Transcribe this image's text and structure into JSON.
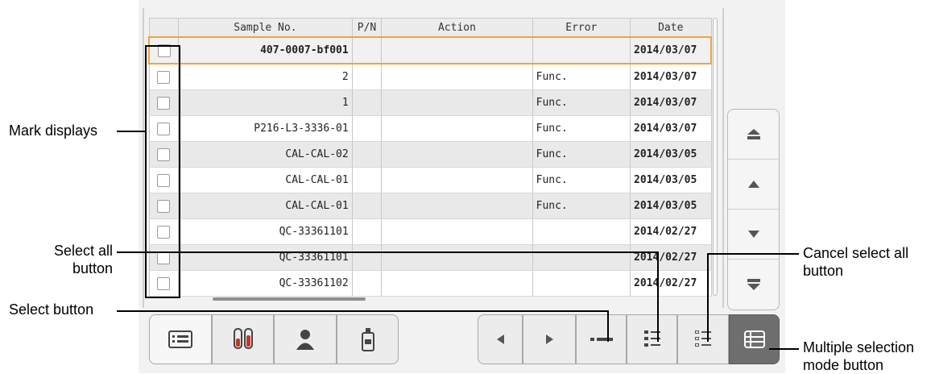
{
  "table": {
    "columns": [
      "",
      "Sample No.",
      "P/N",
      "Action",
      "Error",
      "Date"
    ],
    "rows": [
      {
        "sample": "407-0007-bf001",
        "pn": "",
        "action": "",
        "error": "",
        "date": "2014/03/07"
      },
      {
        "sample": "2",
        "pn": "",
        "action": "",
        "error": "Func.",
        "date": "2014/03/07"
      },
      {
        "sample": "1",
        "pn": "",
        "action": "",
        "error": "Func.",
        "date": "2014/03/07"
      },
      {
        "sample": "P216-L3-3336-01",
        "pn": "",
        "action": "",
        "error": "Func.",
        "date": "2014/03/07"
      },
      {
        "sample": "CAL-CAL-02",
        "pn": "",
        "action": "",
        "error": "Func.",
        "date": "2014/03/05"
      },
      {
        "sample": "CAL-CAL-01",
        "pn": "",
        "action": "",
        "error": "Func.",
        "date": "2014/03/05"
      },
      {
        "sample": "CAL-CAL-01",
        "pn": "",
        "action": "",
        "error": "Func.",
        "date": "2014/03/05"
      },
      {
        "sample": "QC-33361101",
        "pn": "",
        "action": "",
        "error": "",
        "date": "2014/02/27"
      },
      {
        "sample": "QC-33361101",
        "pn": "",
        "action": "",
        "error": "",
        "date": "2014/02/27"
      },
      {
        "sample": "QC-33361102",
        "pn": "",
        "action": "",
        "error": "",
        "date": "2014/02/27"
      }
    ]
  },
  "annotations": {
    "mark_displays": "Mark displays",
    "select_all_1": "Select all",
    "select_all_2": "button",
    "select_button": "Select button",
    "cancel_select_all_1": "Cancel select all",
    "cancel_select_all_2": "button",
    "multi_mode_1": "Multiple selection",
    "multi_mode_2": "mode button"
  },
  "icons": {
    "nav": [
      "double-up-arrow-icon",
      "up-arrow-icon",
      "down-arrow-icon",
      "double-down-arrow-icon"
    ],
    "toolbar": [
      "sample-list-icon",
      "test-tubes-icon",
      "patient-icon",
      "reagent-bottle-icon",
      "left-arrow-icon",
      "right-arrow-icon",
      "select-icon",
      "select-all-icon",
      "cancel-select-all-icon",
      "multi-select-mode-icon"
    ]
  },
  "colors": {
    "selected_row_outline": "#f0a43c",
    "active_button": "#6e6e6e"
  }
}
